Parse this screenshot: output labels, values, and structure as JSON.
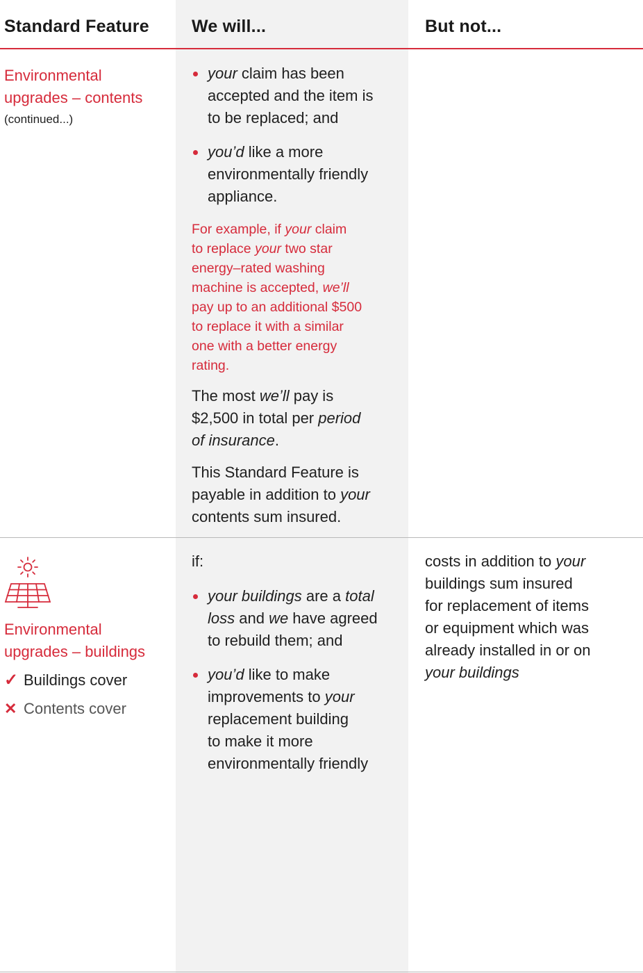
{
  "header": {
    "col1": "Standard Feature",
    "col2": "We will...",
    "col3": "But not..."
  },
  "row1": {
    "feature_title_line1": "Environmental",
    "feature_title_line2": "upgrades – contents",
    "continued": "(continued...)",
    "bullet1": {
      "pre_em": "your",
      "rest_line1": " claim has been",
      "line2": "accepted and the item is",
      "line3": "to be replaced; and"
    },
    "bullet2": {
      "pre_em": "you’d",
      "rest_line1": " like a more",
      "line2": "environmentally friendly",
      "line3": "appliance."
    },
    "example": {
      "t1": "For example, if ",
      "e1": "your",
      "t2": " claim",
      "t3": "to replace ",
      "e2": "your",
      "t4": " two star",
      "t5": "energy–rated washing",
      "t6": "machine is accepted, ",
      "e3": "we’ll",
      "t7": "pay up to an additional $500",
      "t8": "to replace it with a similar",
      "t9": "one with a better energy",
      "t10": "rating."
    },
    "most": {
      "t1": "The most ",
      "e1": "we’ll",
      "t2": " pay is",
      "t3": "$2,500 in total per ",
      "e2": "period",
      "e3": "of insurance",
      "t4": "."
    },
    "addition": {
      "t1": "This Standard Feature is",
      "t2": "payable in addition to ",
      "e1": "your",
      "t3": "contents sum insured."
    }
  },
  "row2": {
    "icon": "solar-panel-icon",
    "feature_title_line1": "Environmental",
    "feature_title_line2": "upgrades – buildings",
    "covers": [
      {
        "label": "Buildings cover",
        "status": "included",
        "icon": "check-icon"
      },
      {
        "label": "Contents cover",
        "status": "excluded",
        "icon": "cross-icon"
      }
    ],
    "if_label": "if:",
    "bullet1": {
      "e1": "your buildings",
      "t1": " are a ",
      "e2": "total",
      "e3": "loss",
      "t2": " and ",
      "e4": "we",
      "t3": " have agreed",
      "t4": "to rebuild them; and"
    },
    "bullet2": {
      "e1": "you’d",
      "t1": " like to make",
      "t2": "improvements to ",
      "e2": "your",
      "t3": "replacement building",
      "t4": "to make it more",
      "t5": "environmentally friendly"
    },
    "but_not": {
      "t1": "costs in addition to ",
      "e1": "your",
      "t2": "buildings sum insured",
      "t3": "for replacement of items",
      "t4": "or equipment which was",
      "t5": "already installed in or on",
      "e2": "your buildings"
    }
  },
  "colors": {
    "accent": "#d62b3b",
    "shade": "#f2f2f2",
    "rule": "#b9b9b9"
  }
}
